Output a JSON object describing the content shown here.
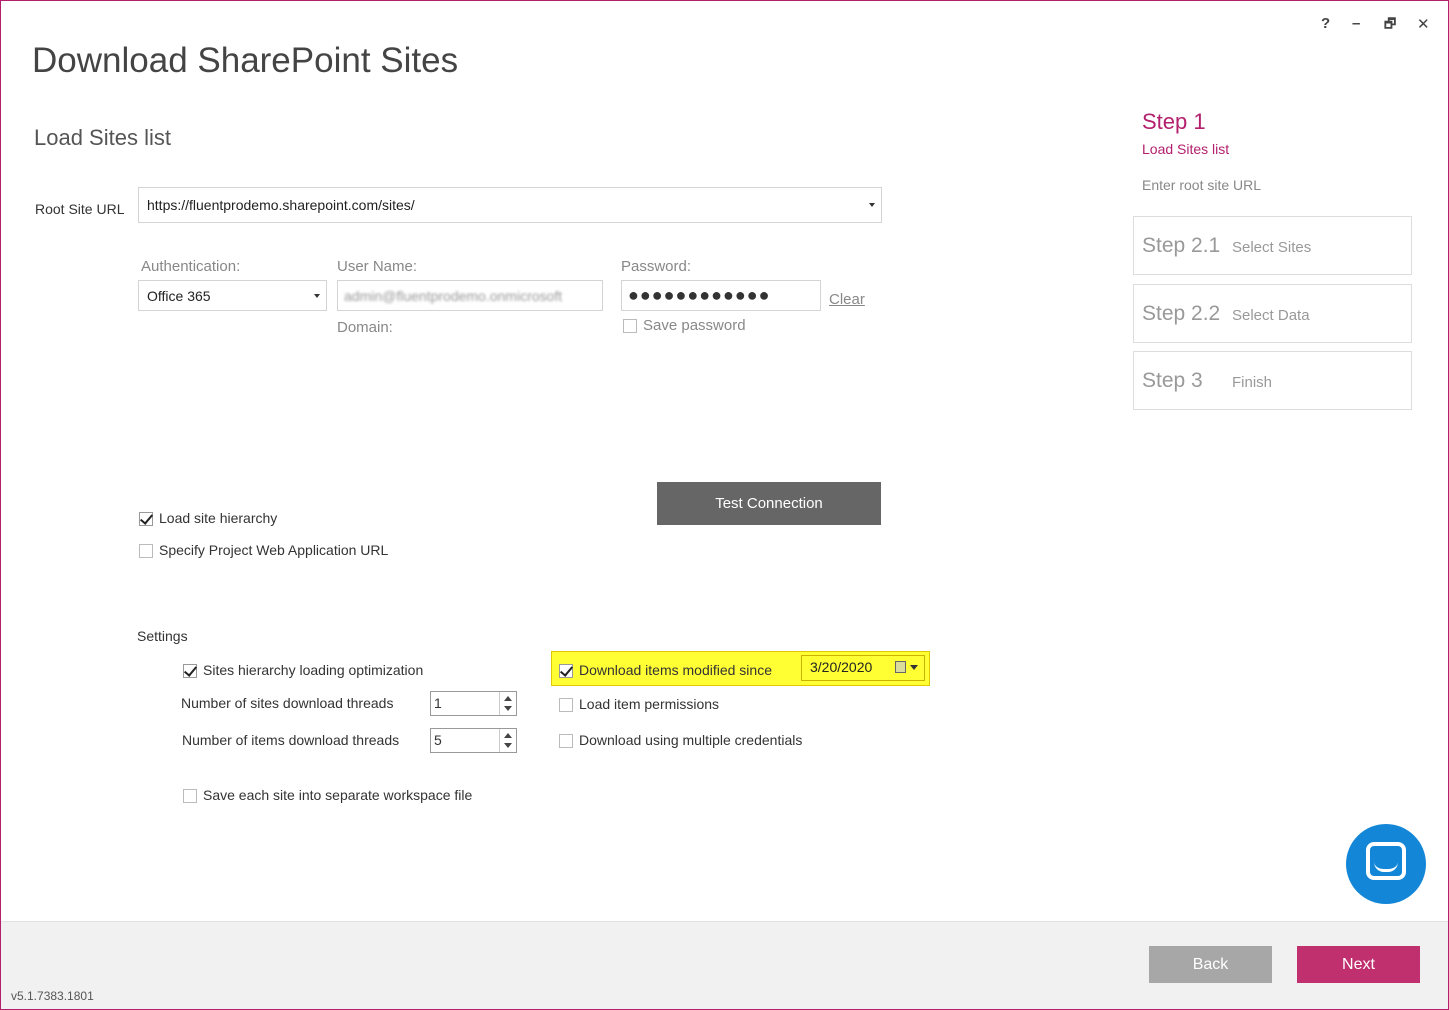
{
  "window": {
    "controls": {
      "help": "?",
      "minimize": "–",
      "restore": "🗗",
      "close": "✕"
    }
  },
  "header": {
    "title": "Download SharePoint Sites",
    "section": "Load Sites list"
  },
  "root_url": {
    "label": "Root Site URL",
    "value": "https://fluentprodemo.sharepoint.com/sites/"
  },
  "auth": {
    "auth_label": "Authentication:",
    "auth_value": "Office 365",
    "user_label": "User Name:",
    "user_value": "admin@fluentprodemo.onmicrosoft",
    "domain_label": "Domain:",
    "password_label": "Password:",
    "password_value": "●●●●●●●●●●●●",
    "clear_label": "Clear",
    "save_password_label": "Save password"
  },
  "test_connection_label": "Test Connection",
  "options": {
    "load_hierarchy": "Load site hierarchy",
    "specify_pwa": "Specify Project Web Application URL"
  },
  "settings": {
    "title": "Settings",
    "hierarchy_opt": "Sites hierarchy loading optimization",
    "sites_threads_label": "Number of sites download threads",
    "sites_threads_value": "1",
    "items_threads_label": "Number of items download threads",
    "items_threads_value": "5",
    "separate_workspace": "Save each site into separate workspace file",
    "modified_since_label": "Download items modified since",
    "modified_since_date": "3/20/2020",
    "load_permissions": "Load item permissions",
    "multiple_credentials": "Download using multiple credentials"
  },
  "steps": {
    "active": {
      "title": "Step 1",
      "subtitle": "Load Sites list",
      "hint": "Enter root site URL"
    },
    "items": [
      {
        "num": "Step 2.1",
        "name": "Select Sites"
      },
      {
        "num": "Step 2.2",
        "name": "Select Data"
      },
      {
        "num": "Step 3",
        "name": "Finish"
      }
    ]
  },
  "footer": {
    "back": "Back",
    "next": "Next",
    "version": "v5.1.7383.1801"
  },
  "colors": {
    "accent": "#b3206e",
    "next_button": "#c0306f",
    "chat": "#1386d8",
    "highlight": "#ffff33"
  }
}
